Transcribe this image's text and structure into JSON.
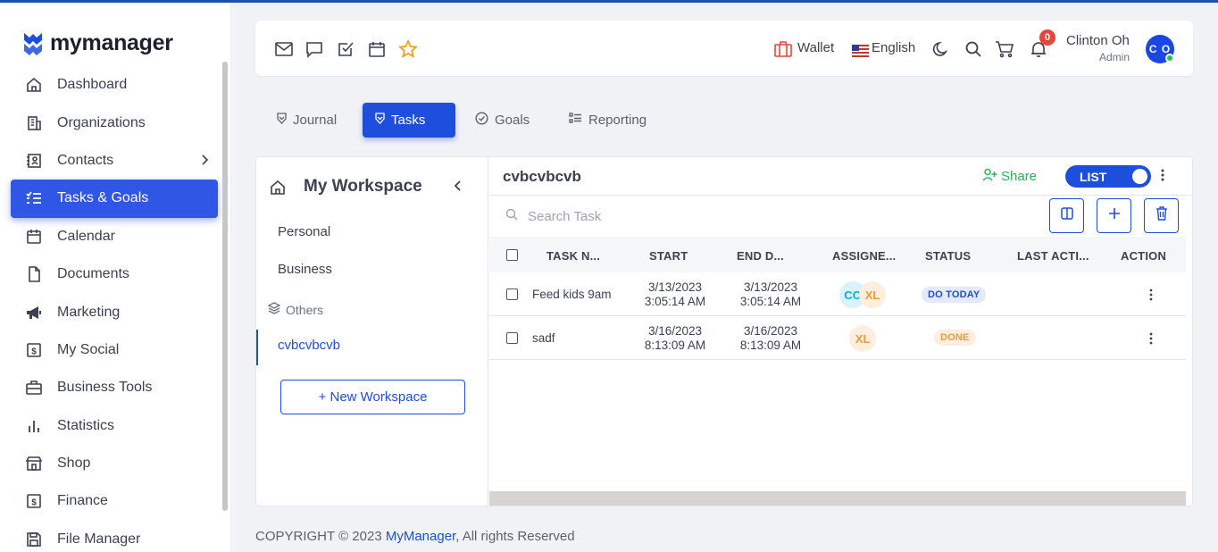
{
  "app": {
    "brand": "mymanager"
  },
  "sidebar": {
    "items": [
      {
        "label": "Dashboard",
        "icon": "home-icon"
      },
      {
        "label": "Organizations",
        "icon": "building-icon"
      },
      {
        "label": "Contacts",
        "icon": "contacts-icon"
      },
      {
        "label": "Tasks & Goals",
        "icon": "checklist-icon",
        "active": true
      },
      {
        "label": "Calendar",
        "icon": "calendar-icon"
      },
      {
        "label": "Documents",
        "icon": "document-icon"
      },
      {
        "label": "Marketing",
        "icon": "megaphone-icon"
      },
      {
        "label": "My Social",
        "icon": "social-icon"
      },
      {
        "label": "Business Tools",
        "icon": "briefcase-icon"
      },
      {
        "label": "Statistics",
        "icon": "bar-chart-icon"
      },
      {
        "label": "Shop",
        "icon": "shop-icon"
      },
      {
        "label": "Finance",
        "icon": "dollar-icon"
      },
      {
        "label": "File Manager",
        "icon": "save-icon"
      }
    ]
  },
  "topbar": {
    "wallet": "Wallet",
    "language": "English",
    "notifications_count": "0",
    "user_name": "Clinton Oh",
    "user_role": "Admin",
    "user_initials": "C O"
  },
  "tabs": [
    {
      "label": "Journal"
    },
    {
      "label": "Tasks"
    },
    {
      "label": "Goals"
    },
    {
      "label": "Reporting"
    }
  ],
  "workspace": {
    "title": "My Workspace",
    "items": [
      "Personal",
      "Business"
    ],
    "others_label": "Others",
    "active": "cvbcvbcvb",
    "new_button": "+ New Workspace"
  },
  "main": {
    "title": "cvbcvbcvb",
    "share": "Share",
    "view_toggle": "LIST",
    "search_placeholder": "Search Task",
    "columns": [
      "TASK N...",
      "START",
      "END D...",
      "ASSIGNE...",
      "STATUS",
      "LAST ACTI...",
      "ACTION"
    ],
    "rows": [
      {
        "task": "Feed kids 9am",
        "start_date": "3/13/2023",
        "start_time": "3:05:14 AM",
        "end_date": "3/13/2023",
        "end_time": "3:05:14 AM",
        "assignees": [
          "CO",
          "XL"
        ],
        "status": "DO TODAY"
      },
      {
        "task": "sadf",
        "start_date": "3/16/2023",
        "start_time": "8:13:09 AM",
        "end_date": "3/16/2023",
        "end_time": "8:13:09 AM",
        "assignees": [
          "XL"
        ],
        "status": "DONE"
      }
    ]
  },
  "footer": {
    "prefix": "COPYRIGHT © 2023 ",
    "link": "MyManager",
    "suffix": ", All rights Reserved"
  },
  "colors": {
    "primary": "#1d4fdc",
    "sidebar_active": "#2f56e4",
    "share_green": "#27b45a",
    "badge_red": "#e8453c"
  }
}
